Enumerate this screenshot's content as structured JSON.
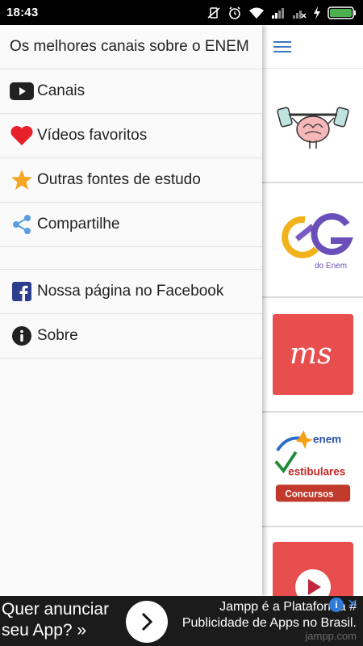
{
  "status_bar": {
    "time": "18:43",
    "icons": [
      "vibrate-off-icon",
      "alarm-icon",
      "wifi-icon",
      "signal-icon",
      "signal-no-service-icon",
      "charging-icon",
      "battery-icon"
    ]
  },
  "drawer": {
    "title": "Os melhores canais sobre o ENEM",
    "items": [
      {
        "label": "Canais",
        "icon": "youtube-play-icon"
      },
      {
        "label": "Vídeos favoritos",
        "icon": "heart-icon"
      },
      {
        "label": "Outras fontes de estudo",
        "icon": "star-icon"
      },
      {
        "label": "Compartilhe",
        "icon": "share-icon"
      }
    ],
    "secondary_items": [
      {
        "label": "Nossa página no Facebook",
        "icon": "facebook-icon"
      },
      {
        "label": "Sobre",
        "icon": "info-icon"
      }
    ]
  },
  "background": {
    "menu_icon": "hamburger-menu-icon",
    "logo_texts": {
      "og_sub": "do Enem",
      "ms": "ms",
      "enem": "enem",
      "vestibulares": "estibulares",
      "concursos": "Concursos"
    }
  },
  "ad": {
    "left_line1": "Quer anunciar",
    "left_line2": "seu App? »",
    "right_line1": "Jampp é a Plataforma #",
    "right_line2": "Publicidade de Apps no Brasil.",
    "domain": "jampp.com"
  },
  "colors": {
    "heart": "#e8202a",
    "star": "#f5a623",
    "share": "#5b9ee0",
    "facebook": "#2c3e8c",
    "menu": "#3a75c4"
  }
}
